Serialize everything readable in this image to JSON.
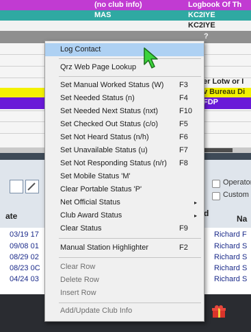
{
  "top_row": {
    "col1": "(no club info)",
    "col2": "Logbook Of Th"
  },
  "row_teal": {
    "col1": "MAS",
    "col2": "KC2IYE"
  },
  "row_two": {
    "col2": "KC2IYE"
  },
  "right_column_fragments": {
    "qmark": "?",
    "lotw": "er Lotw or I",
    "bureau": "v Bureau Di",
    "fdp": "FDP"
  },
  "lower_panel": {
    "operator_label": "Operator",
    "custom_label": "Custom I",
    "col_date_header": "ate",
    "col_d_header": "d",
    "col_name_header": "Na"
  },
  "log_rows": [
    {
      "date": "03/19 17",
      "name": "Richard F"
    },
    {
      "date": "09/08 01",
      "name": "Richard S"
    },
    {
      "date": "08/29 02",
      "name": "Richard S"
    },
    {
      "date": "08/23 0C",
      "name": "Richard S"
    },
    {
      "date": "04/24 03",
      "name": "Richard S"
    }
  ],
  "context_menu": {
    "items": [
      {
        "label": "Log Contact",
        "shortcut": "",
        "highlighted": true
      },
      {
        "label": "Qrz Web Page Lookup",
        "shortcut": ""
      },
      {
        "label": "Set Manual Worked Status (W)",
        "shortcut": "F3"
      },
      {
        "label": "Set Needed Status (n)",
        "shortcut": "F4"
      },
      {
        "label": "Set Needed Next Status (nxt)",
        "shortcut": "F10"
      },
      {
        "label": "Set Checked Out Status (c/o)",
        "shortcut": "F5"
      },
      {
        "label": "Set Not Heard Status (n/h)",
        "shortcut": "F6"
      },
      {
        "label": "Set Unavailable Status (u)",
        "shortcut": "F7"
      },
      {
        "label": "Set Not Responding Status (n/r)",
        "shortcut": "F8"
      },
      {
        "label": "Set Mobile Status 'M'",
        "shortcut": ""
      },
      {
        "label": "Clear Portable Status 'P'",
        "shortcut": ""
      },
      {
        "label": "Net Official Status",
        "submenu": true
      },
      {
        "label": "Club Award Status",
        "submenu": true
      },
      {
        "label": "Clear Status",
        "shortcut": "F9"
      },
      {
        "label": "Manual Station Highlighter",
        "shortcut": "F2"
      },
      {
        "label": "Clear Row",
        "shortcut": ""
      },
      {
        "label": "Delete Row",
        "shortcut": ""
      },
      {
        "label": "Insert Row",
        "shortcut": ""
      },
      {
        "label": "Add/Update Club Info",
        "shortcut": ""
      }
    ]
  },
  "colors": {
    "magenta_row": "#c13bd2",
    "teal_row": "#2fa9a2",
    "yellow_band": "#f3f100",
    "purple_band": "#6a1ad8",
    "menu_highlight": "#aed1f3",
    "name_link": "#1a2a8a"
  },
  "icons": {
    "pointer": "mouse-pointer-icon",
    "gift": "gift-icon",
    "submenu": "chevron-right-icon"
  }
}
